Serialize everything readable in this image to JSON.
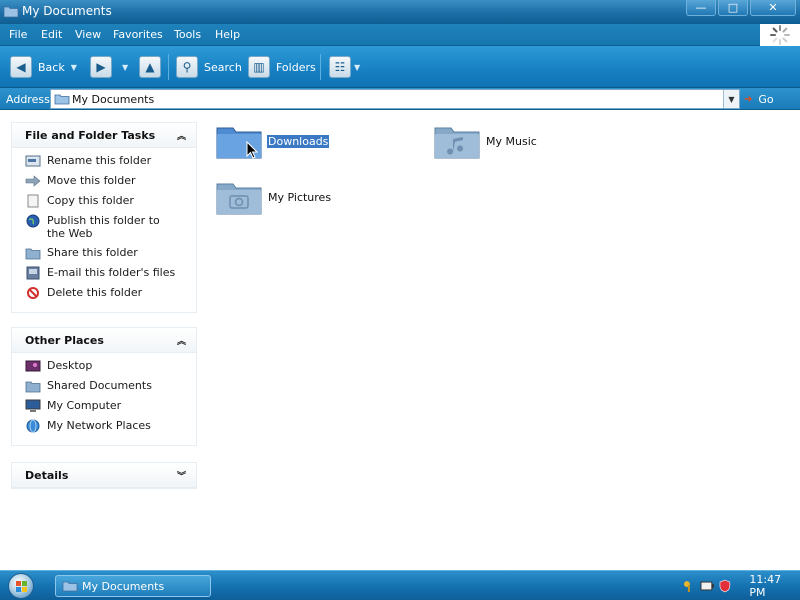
{
  "window": {
    "title": "My Documents"
  },
  "window_buttons": {
    "minimize": "—",
    "maximize": "□",
    "close": "✕"
  },
  "menu": [
    "File",
    "Edit",
    "View",
    "Favorites",
    "Tools",
    "Help"
  ],
  "toolbar": {
    "back": "Back",
    "search": "Search",
    "folders": "Folders"
  },
  "address": {
    "label": "Address",
    "value": "My Documents",
    "go": "Go"
  },
  "tasks_panel": {
    "title": "File and Folder Tasks",
    "items": [
      {
        "label": "Rename this folder",
        "icon": "rename-icon"
      },
      {
        "label": "Move this folder",
        "icon": "move-icon"
      },
      {
        "label": "Copy this folder",
        "icon": "copy-icon"
      },
      {
        "label": "Publish this folder to the Web",
        "icon": "globe-icon"
      },
      {
        "label": "Share this folder",
        "icon": "share-icon"
      },
      {
        "label": "E-mail this folder's files",
        "icon": "email-icon"
      },
      {
        "label": "Delete this folder",
        "icon": "delete-icon"
      }
    ]
  },
  "places_panel": {
    "title": "Other Places",
    "items": [
      {
        "label": "Desktop",
        "icon": "desktop-icon"
      },
      {
        "label": "Shared Documents",
        "icon": "folder-icon"
      },
      {
        "label": "My Computer",
        "icon": "computer-icon"
      },
      {
        "label": "My Network Places",
        "icon": "network-icon"
      }
    ]
  },
  "details_panel": {
    "title": "Details"
  },
  "files": [
    {
      "name": "Downloads",
      "icon": "folder-icon",
      "selected": true
    },
    {
      "name": "My Music",
      "icon": "music-folder-icon",
      "selected": false
    },
    {
      "name": "My Pictures",
      "icon": "pictures-folder-icon",
      "selected": false
    }
  ],
  "taskbar": {
    "task": "My Documents",
    "clock": "11:47 PM"
  },
  "colors": {
    "accent": "#1a7cb9",
    "selection": "#3b79c4",
    "folder": "#5b93cf"
  }
}
